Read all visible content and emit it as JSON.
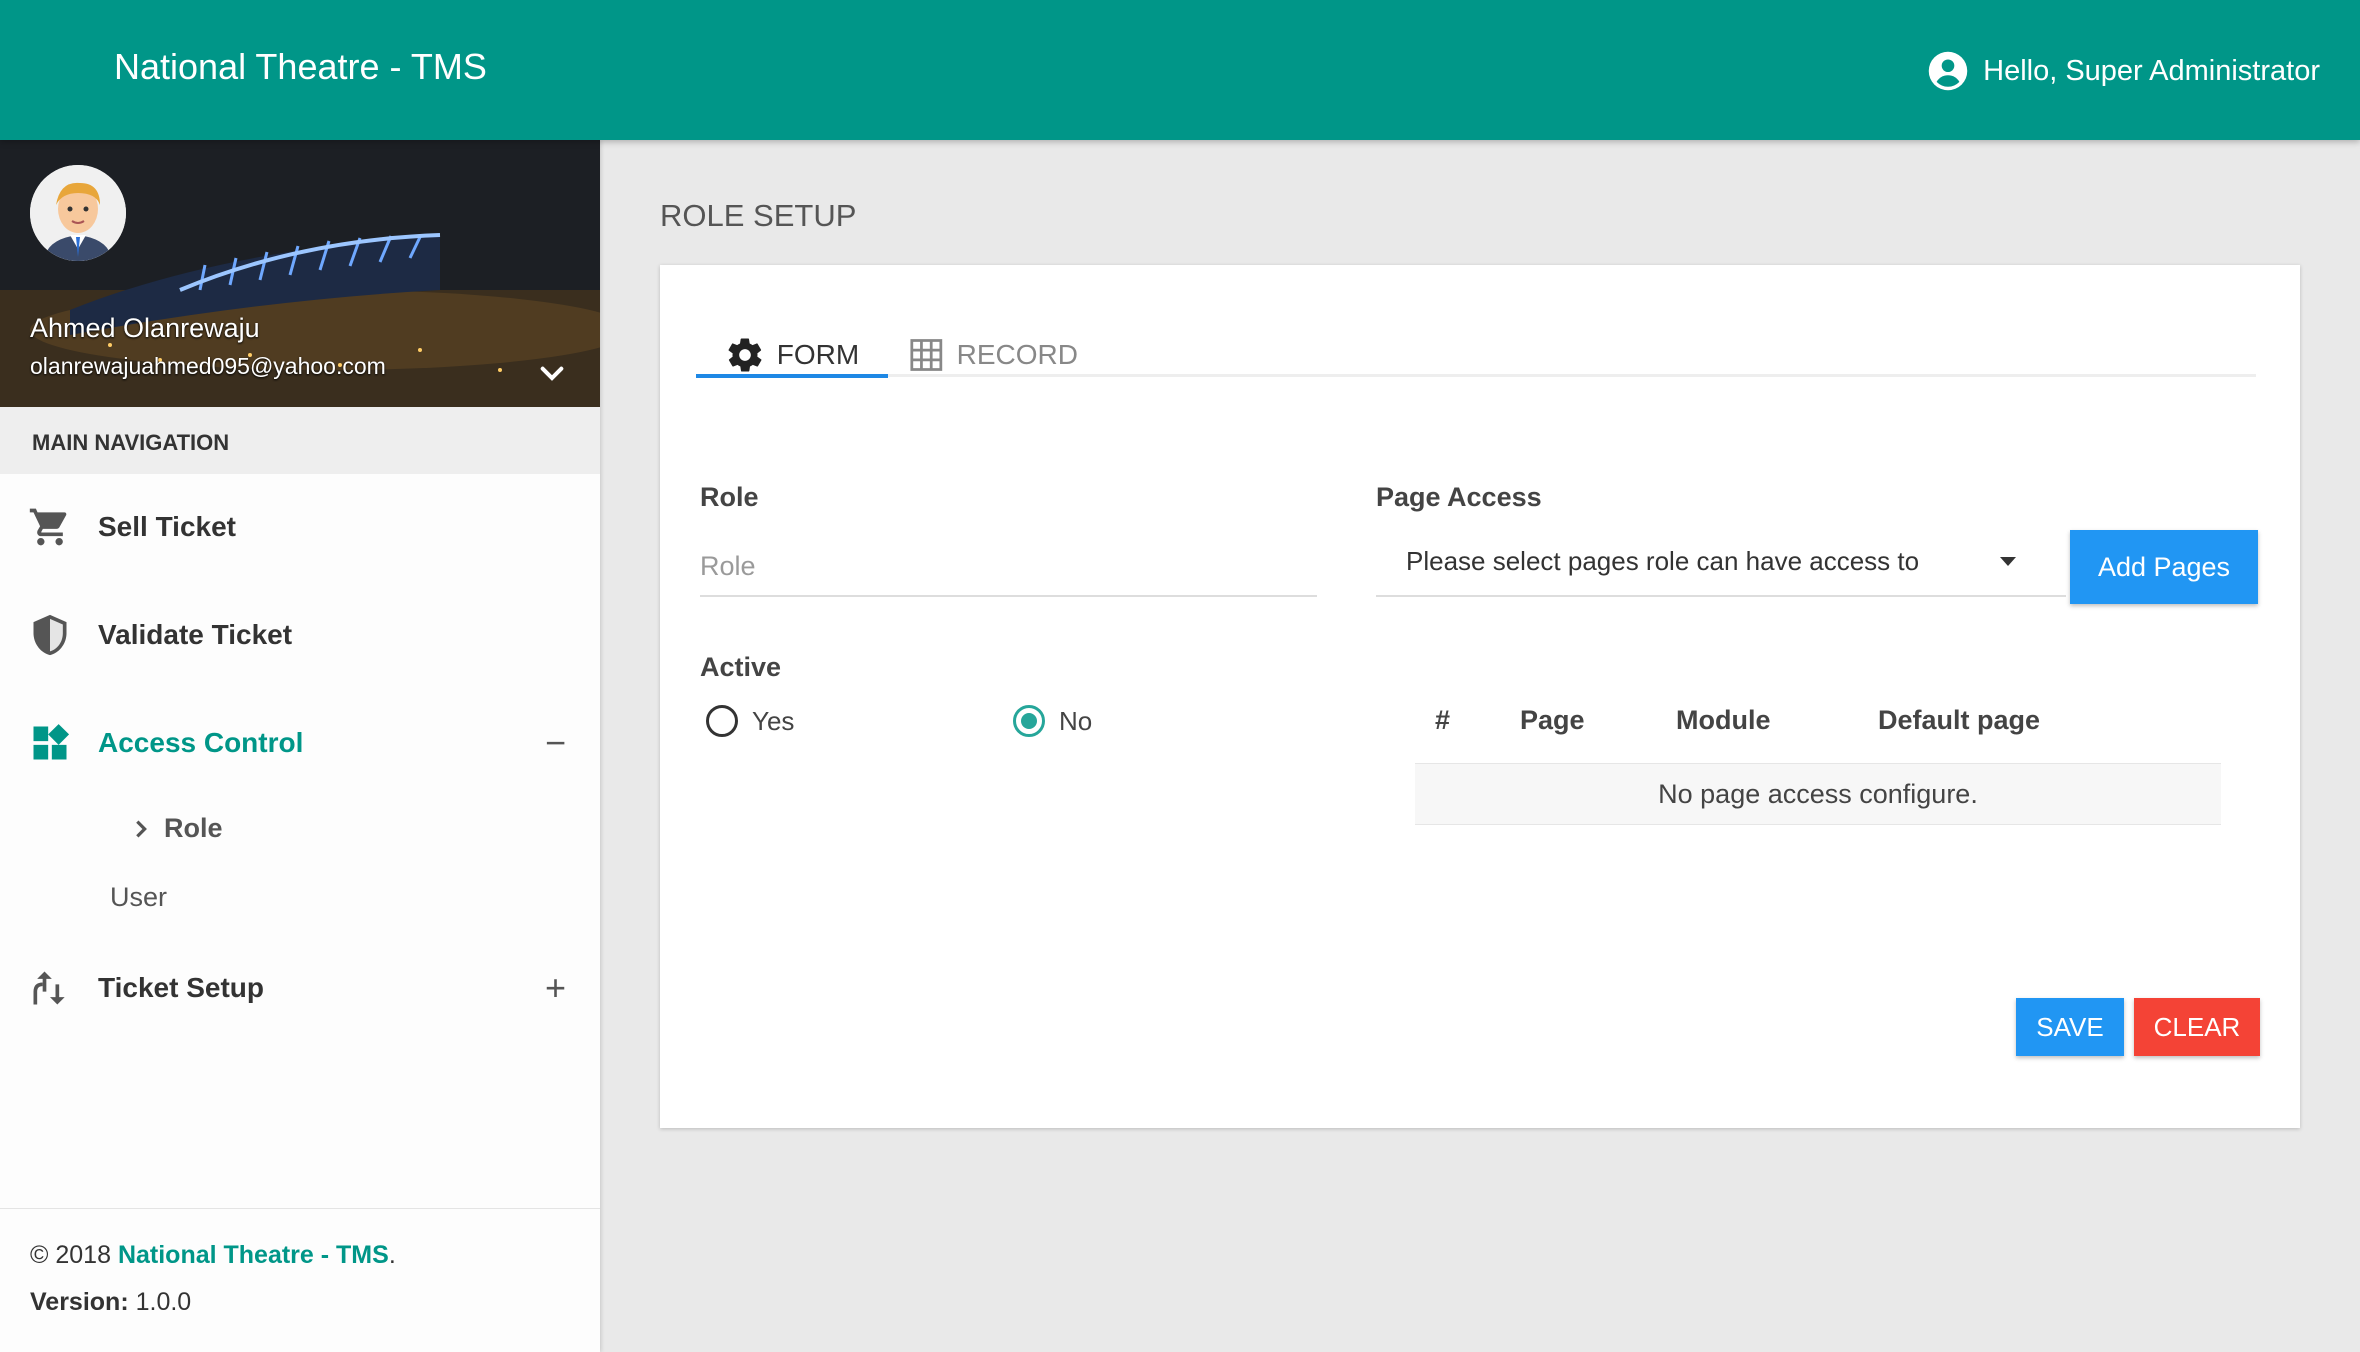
{
  "app": {
    "brand": "National Theatre - TMS",
    "greeting": "Hello, Super Administrator"
  },
  "profile": {
    "name": "Ahmed Olanrewaju",
    "email": "olanrewajuahmed095@yahoo.com"
  },
  "sidebar": {
    "header": "MAIN NAVIGATION",
    "items": [
      {
        "label": "Sell Ticket",
        "icon": "cart-icon"
      },
      {
        "label": "Validate Ticket",
        "icon": "shield-icon"
      },
      {
        "label": "Access Control",
        "icon": "widgets-icon",
        "toggle": "−",
        "active": true,
        "children": [
          {
            "label": "Role"
          },
          {
            "label": "User"
          }
        ]
      },
      {
        "label": "Ticket Setup",
        "icon": "swap-icon",
        "toggle": "+"
      }
    ],
    "footer": {
      "copyright": "© 2018 ",
      "brand": "National Theatre - TMS",
      "dot": ".",
      "version_label": "Version:",
      "version": " 1.0.0"
    }
  },
  "page": {
    "title": "ROLE SETUP",
    "tabs": [
      {
        "label": "FORM",
        "icon": "gear-icon",
        "active": true
      },
      {
        "label": "RECORD",
        "icon": "grid-icon"
      }
    ],
    "form": {
      "role_label": "Role",
      "role_placeholder": "Role",
      "role_value": "",
      "active_label": "Active",
      "active_options": [
        {
          "label": "Yes",
          "checked": false
        },
        {
          "label": "No",
          "checked": true
        }
      ],
      "page_access_label": "Page Access",
      "page_access_select": "Please select pages role can have access to",
      "add_pages_label": "Add Pages"
    },
    "table": {
      "headers": [
        "#",
        "Page",
        "Module",
        "Default page"
      ],
      "empty_message": "No page access configure."
    },
    "actions": {
      "save": "SAVE",
      "clear": "CLEAR"
    }
  },
  "colors": {
    "primary": "#009688",
    "accent_blue": "#2196f3",
    "danger": "#f44336",
    "radio": "#26a69a"
  }
}
